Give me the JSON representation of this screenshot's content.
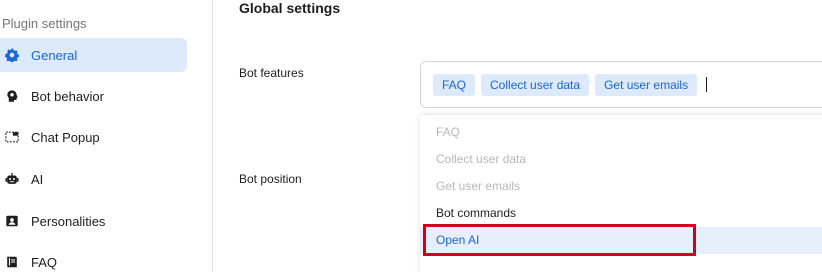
{
  "sidebar": {
    "heading": "Plugin settings",
    "items": [
      {
        "label": "General",
        "icon": "gear-icon",
        "active": true
      },
      {
        "label": "Bot behavior",
        "icon": "head-gear-icon",
        "active": false
      },
      {
        "label": "Chat Popup",
        "icon": "popup-window-icon",
        "active": false
      },
      {
        "label": "AI",
        "icon": "robot-icon",
        "active": false
      },
      {
        "label": "Personalities",
        "icon": "id-card-icon",
        "active": false
      },
      {
        "label": "FAQ",
        "icon": "book-icon",
        "active": false
      }
    ]
  },
  "main": {
    "section_title": "Global settings",
    "fields": {
      "bot_features_label": "Bot features",
      "bot_position_label": "Bot position"
    },
    "bot_features": {
      "selected_chips": [
        "FAQ",
        "Collect user data",
        "Get user emails"
      ],
      "options": [
        {
          "label": "FAQ",
          "state": "disabled"
        },
        {
          "label": "Collect user data",
          "state": "disabled"
        },
        {
          "label": "Get user emails",
          "state": "disabled"
        },
        {
          "label": "Bot commands",
          "state": "enabled"
        },
        {
          "label": "Open AI",
          "state": "focused"
        }
      ]
    }
  },
  "colors": {
    "accent": "#1a66d6",
    "active_bg": "#dceafc",
    "highlight": "#d0021b",
    "disabled_text": "#b8b8b8"
  }
}
